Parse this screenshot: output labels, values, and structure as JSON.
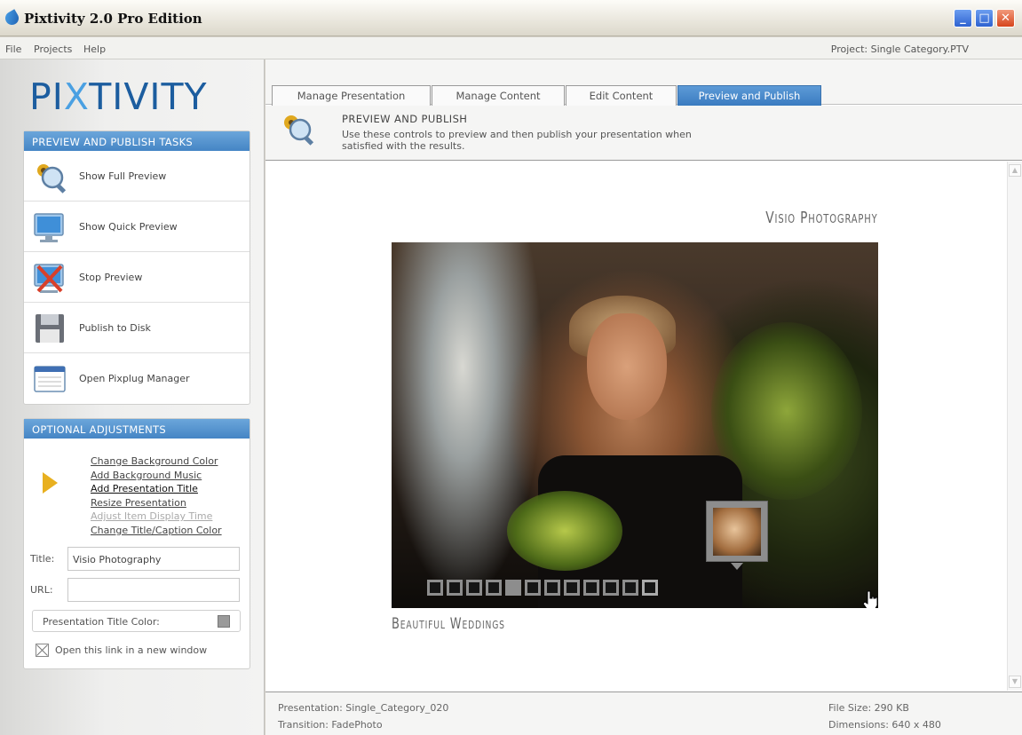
{
  "window": {
    "title": "Pixtivity 2.0 Pro Edition"
  },
  "menu": {
    "items": [
      "File",
      "Projects",
      "Help"
    ],
    "project_label": "Project: Single Category.PTV"
  },
  "logo": {
    "part1": "PI",
    "part2": "X",
    "part3": "TIVITY"
  },
  "tasks_panel": {
    "header": "PREVIEW AND PUBLISH TASKS",
    "items": [
      {
        "label": "Show Full Preview",
        "icon": "magnifier-flower-icon"
      },
      {
        "label": "Show Quick Preview",
        "icon": "monitor-icon"
      },
      {
        "label": "Stop Preview",
        "icon": "stop-monitor-icon"
      },
      {
        "label": "Publish to Disk",
        "icon": "floppy-disk-icon"
      },
      {
        "label": "Open Pixplug Manager",
        "icon": "window-app-icon"
      }
    ]
  },
  "adjust_panel": {
    "header": "OPTIONAL ADJUSTMENTS",
    "links": [
      {
        "label": "Change Background Color",
        "state": "normal"
      },
      {
        "label": "Add Background Music",
        "state": "normal"
      },
      {
        "label": "Add Presentation Title",
        "state": "active"
      },
      {
        "label": "Resize Presentation",
        "state": "normal"
      },
      {
        "label": "Adjust Item Display Time",
        "state": "disabled"
      },
      {
        "label": "Change Title/Caption Color",
        "state": "normal"
      }
    ],
    "title_label": "Title:",
    "title_value": "Visio Photography",
    "url_label": "URL:",
    "url_value": "",
    "color_label": "Presentation Title Color:",
    "color_value": "#9a9a9a",
    "checkbox_label": "Open this link in a new window"
  },
  "tabs": [
    {
      "label": "Manage Presentation",
      "active": false
    },
    {
      "label": "Manage Content",
      "active": false
    },
    {
      "label": "Edit Content",
      "active": false
    },
    {
      "label": "Preview and Publish",
      "active": true
    }
  ],
  "header": {
    "title": "PREVIEW AND PUBLISH",
    "description": "Use these controls to preview and then publish your presentation when satisfied with the results."
  },
  "preview": {
    "title": "Visio Photography",
    "subtitle": "Beautiful Weddings",
    "thumbnail_count": 12,
    "selected_thumbnail": 5,
    "hovered_thumbnail": 12
  },
  "status": {
    "presentation": "Presentation: Single_Category_020",
    "transition": "Transition: FadePhoto",
    "file_size": "File Size: 290 KB",
    "dimensions": "Dimensions: 640 x 480"
  },
  "colors": {
    "accent": "#4585c5",
    "logo_dark": "#1c5d9f",
    "logo_light": "#4aa0e2"
  }
}
